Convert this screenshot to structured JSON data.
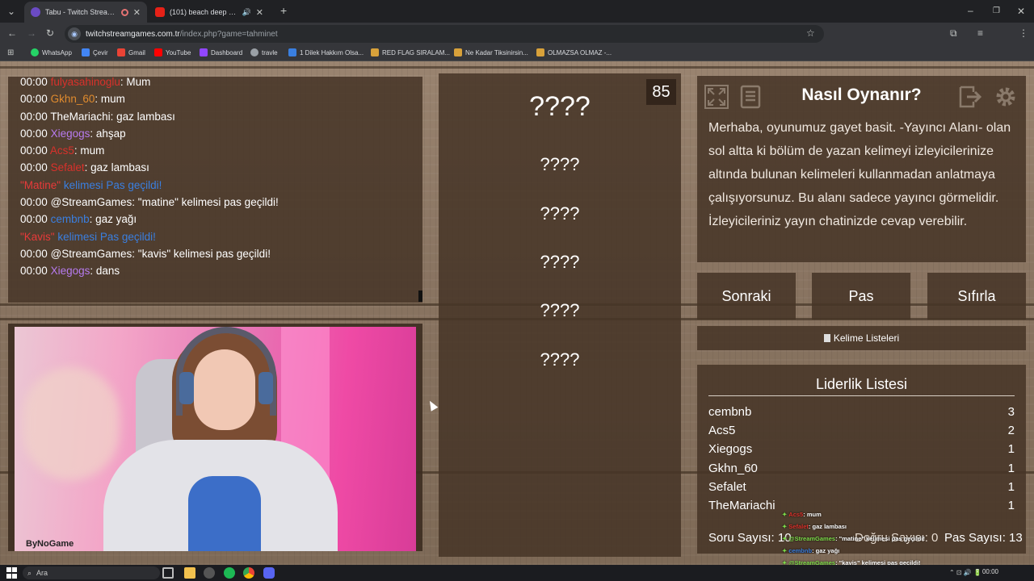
{
  "browser": {
    "tabs": [
      {
        "label": "Tabu - Twitch Stream Games",
        "active": true
      },
      {
        "label": "(101) beach deep house mix",
        "active": false
      }
    ],
    "url_host": "twitchstreamgames.com.tr",
    "url_path": "/index.php?game=tahminet",
    "bookmarks": [
      "WhatsApp",
      "Çevir",
      "Gmail",
      "YouTube",
      "Dashboard",
      "travle",
      "1 Dilek Hakkım Olsa...",
      "RED FLAG SIRALAM...",
      "Ne Kadar Tiksinirsin...",
      "OLMAZSA OLMAZ -..."
    ],
    "profile_initial": "E"
  },
  "chat": {
    "lines": [
      {
        "ts": "00:00",
        "user": "fulyasahinoglu",
        "user_color": "#d9312b",
        "msg": ": Mum"
      },
      {
        "ts": "00:00",
        "user": "Gkhn_60",
        "user_color": "#e08b2e",
        "msg": ": mum"
      },
      {
        "ts": "00:00",
        "user": "TheMariachi",
        "user_color": "#ffffff",
        "msg": ": gaz lambası"
      },
      {
        "ts": "00:00",
        "user": "Xiegogs",
        "user_color": "#b77bf0",
        "msg": ": ahşap"
      },
      {
        "ts": "00:00",
        "user": "Acs5",
        "user_color": "#d9312b",
        "msg": ": mum"
      },
      {
        "ts": "00:00",
        "user": "Sefalet",
        "user_color": "#d9312b",
        "msg": ": gaz lambası"
      },
      {
        "ts": "",
        "user": "\"Matine\"",
        "user_color": "#e83a3a",
        "msg": " kelimesi Pas geçildi!",
        "system": true
      },
      {
        "ts": "00:00",
        "user": "@StreamGames",
        "user_color": "#ffffff",
        "msg": ": \"matine\" kelimesi pas geçildi!"
      },
      {
        "ts": "00:00",
        "user": "cembnb",
        "user_color": "#3a7fe0",
        "msg": ": gaz yağı"
      },
      {
        "ts": "",
        "user": "\"Kavis\"",
        "user_color": "#e83a3a",
        "msg": " kelimesi Pas geçildi!",
        "system": true
      },
      {
        "ts": "00:00",
        "user": "@StreamGames",
        "user_color": "#ffffff",
        "msg": ": \"kavis\" kelimesi pas geçildi!"
      },
      {
        "ts": "00:00",
        "user": "Xiegogs",
        "user_color": "#b77bf0",
        "msg": ": dans"
      }
    ]
  },
  "stream": {
    "logo": "ByNoGame"
  },
  "timer": "85",
  "words": {
    "main": "????",
    "forbidden": [
      "????",
      "????",
      "????",
      "????",
      "????"
    ]
  },
  "how_to": {
    "title": "Nasıl Oynanır?",
    "text": "Merhaba, oyunumuz gayet basit. -Yayıncı Alanı- olan sol altta ki bölüm de yazan kelimeyi izleyicilerinize altında bulunan kelimeleri kullanmadan anlatmaya çalışıyorsunuz. Bu alanı sadece yayıncı görmelidir. İzleyicileriniz yayın chatinizde cevap verebilir."
  },
  "actions": {
    "next": "Sonraki",
    "pass": "Pas",
    "reset": "Sıfırla",
    "lists": "Kelime Listeleri"
  },
  "leaderboard": {
    "title": "Liderlik Listesi",
    "rows": [
      {
        "name": "cembnb",
        "score": "3"
      },
      {
        "name": "Acs5",
        "score": "2"
      },
      {
        "name": "Xiegogs",
        "score": "1"
      },
      {
        "name": "Gkhn_60",
        "score": "1"
      },
      {
        "name": "Sefalet",
        "score": "1"
      },
      {
        "name": "TheMariachi",
        "score": "1"
      }
    ],
    "question_count": "Soru Sayısı: 10",
    "correct_count": "Doğru Sayısı: 0",
    "pass_count": "Pas Sayısı: 13"
  },
  "overlay_chat": [
    {
      "user": "Acs5",
      "color": "#d9312b",
      "msg": ": mum"
    },
    {
      "user": "Sefalet",
      "color": "#d9312b",
      "msg": ": gaz lambası"
    },
    {
      "user": "@StreamGames",
      "color": "#7ddb4a",
      "msg": ": \"matine\" kelimesi pas geçildi!"
    },
    {
      "user": "cembnb",
      "color": "#3a7fe0",
      "msg": ": gaz yağı"
    },
    {
      "user": "@StreamGames",
      "color": "#7ddb4a",
      "msg": ": \"kavis\" kelimesi pas geçildi!"
    },
    {
      "user": "Xiegogs",
      "color": "#b77bf0",
      "msg": ": dans"
    }
  ],
  "taskbar": {
    "search_placeholder": "Ara",
    "clock": "00:00"
  }
}
